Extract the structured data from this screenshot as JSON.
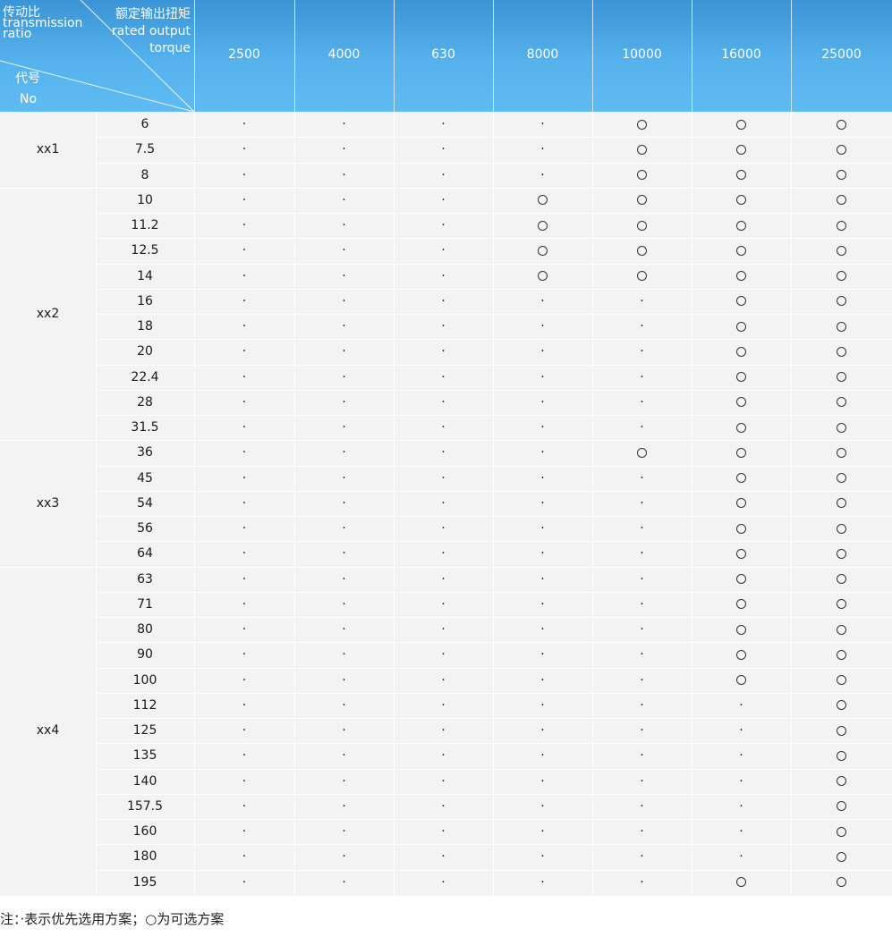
{
  "header": {
    "corner_top_right": [
      "额定输出扭矩",
      "rated output",
      "torque"
    ],
    "corner_top_left": [
      "传动比",
      "transmission",
      "ratio"
    ],
    "corner_bottom_left": [
      "代号",
      "No"
    ],
    "torques": [
      "2500",
      "4000",
      "630",
      "8000",
      "10000",
      "16000",
      "25000"
    ]
  },
  "symbols": {
    "dot": "·",
    "circle": "○"
  },
  "groups": [
    {
      "code": "xx1",
      "rows": [
        {
          "ratio": "6",
          "marks": [
            "·",
            "·",
            "·",
            "·",
            "○",
            "○",
            "○"
          ]
        },
        {
          "ratio": "7.5",
          "marks": [
            "·",
            "·",
            "·",
            "·",
            "○",
            "○",
            "○"
          ]
        },
        {
          "ratio": "8",
          "marks": [
            "·",
            "·",
            "·",
            "·",
            "○",
            "○",
            "○"
          ]
        }
      ]
    },
    {
      "code": "xx2",
      "rows": [
        {
          "ratio": "10",
          "marks": [
            "·",
            "·",
            "·",
            "○",
            "○",
            "○",
            "○"
          ]
        },
        {
          "ratio": "11.2",
          "marks": [
            "·",
            "·",
            "·",
            "○",
            "○",
            "○",
            "○"
          ]
        },
        {
          "ratio": "12.5",
          "marks": [
            "·",
            "·",
            "·",
            "○",
            "○",
            "○",
            "○"
          ]
        },
        {
          "ratio": "14",
          "marks": [
            "·",
            "·",
            "·",
            "○",
            "○",
            "○",
            "○"
          ]
        },
        {
          "ratio": "16",
          "marks": [
            "·",
            "·",
            "·",
            "·",
            "·",
            "○",
            "○"
          ]
        },
        {
          "ratio": "18",
          "marks": [
            "·",
            "·",
            "·",
            "·",
            "·",
            "○",
            "○"
          ]
        },
        {
          "ratio": "20",
          "marks": [
            "·",
            "·",
            "·",
            "·",
            "·",
            "○",
            "○"
          ]
        },
        {
          "ratio": "22.4",
          "marks": [
            "·",
            "·",
            "·",
            "·",
            "·",
            "○",
            "○"
          ]
        },
        {
          "ratio": "28",
          "marks": [
            "·",
            "·",
            "·",
            "·",
            "·",
            "○",
            "○"
          ]
        },
        {
          "ratio": "31.5",
          "marks": [
            "·",
            "·",
            "·",
            "·",
            "·",
            "○",
            "○"
          ]
        }
      ]
    },
    {
      "code": "xx3",
      "rows": [
        {
          "ratio": "36",
          "marks": [
            "·",
            "·",
            "·",
            "·",
            "○",
            "○",
            "○"
          ]
        },
        {
          "ratio": "45",
          "marks": [
            "·",
            "·",
            "·",
            "·",
            "·",
            "○",
            "○"
          ]
        },
        {
          "ratio": "54",
          "marks": [
            "·",
            "·",
            "·",
            "·",
            "·",
            "○",
            "○"
          ]
        },
        {
          "ratio": "56",
          "marks": [
            "·",
            "·",
            "·",
            "·",
            "·",
            "○",
            "○"
          ]
        },
        {
          "ratio": "64",
          "marks": [
            "·",
            "·",
            "·",
            "·",
            "·",
            "○",
            "○"
          ]
        }
      ]
    },
    {
      "code": "xx4",
      "rows": [
        {
          "ratio": "63",
          "marks": [
            "·",
            "·",
            "·",
            "·",
            "·",
            "○",
            "○"
          ]
        },
        {
          "ratio": "71",
          "marks": [
            "·",
            "·",
            "·",
            "·",
            "·",
            "○",
            "○"
          ]
        },
        {
          "ratio": "80",
          "marks": [
            "·",
            "·",
            "·",
            "·",
            "·",
            "○",
            "○"
          ]
        },
        {
          "ratio": "90",
          "marks": [
            "·",
            "·",
            "·",
            "·",
            "·",
            "○",
            "○"
          ]
        },
        {
          "ratio": "100",
          "marks": [
            "·",
            "·",
            "·",
            "·",
            "·",
            "○",
            "○"
          ]
        },
        {
          "ratio": "112",
          "marks": [
            "·",
            "·",
            "·",
            "·",
            "·",
            "·",
            "○"
          ]
        },
        {
          "ratio": "125",
          "marks": [
            "·",
            "·",
            "·",
            "·",
            "·",
            "·",
            "○"
          ]
        },
        {
          "ratio": "135",
          "marks": [
            "·",
            "·",
            "·",
            "·",
            "·",
            "·",
            "○"
          ]
        },
        {
          "ratio": "140",
          "marks": [
            "·",
            "·",
            "·",
            "·",
            "·",
            "·",
            "○"
          ]
        },
        {
          "ratio": "157.5",
          "marks": [
            "·",
            "·",
            "·",
            "·",
            "·",
            "·",
            "○"
          ]
        },
        {
          "ratio": "160",
          "marks": [
            "·",
            "·",
            "·",
            "·",
            "·",
            "·",
            "○"
          ]
        },
        {
          "ratio": "180",
          "marks": [
            "·",
            "·",
            "·",
            "·",
            "·",
            "·",
            "○"
          ]
        },
        {
          "ratio": "195",
          "marks": [
            "·",
            "·",
            "·",
            "·",
            "·",
            "○",
            "○"
          ]
        }
      ]
    }
  ],
  "note": "注：·表示优先选用方案；○为可选方案"
}
